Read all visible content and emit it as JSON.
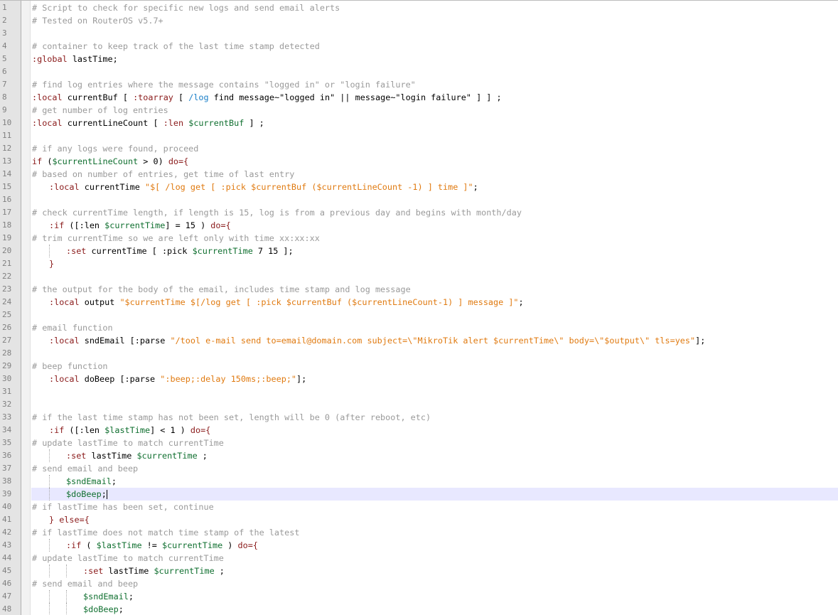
{
  "editor": {
    "current_line": 39,
    "lines": [
      {
        "n": "1",
        "indent": 0,
        "tokens": [
          {
            "t": "c",
            "v": "# Script to check for specific new logs and send email alerts"
          }
        ]
      },
      {
        "n": "2",
        "indent": 0,
        "tokens": [
          {
            "t": "c",
            "v": "# Tested on RouterOS v5.7+"
          }
        ]
      },
      {
        "n": "3",
        "indent": 0,
        "tokens": []
      },
      {
        "n": "4",
        "indent": 0,
        "tokens": [
          {
            "t": "c",
            "v": "# container to keep track of the last time stamp detected"
          }
        ]
      },
      {
        "n": "5",
        "indent": 0,
        "tokens": [
          {
            "t": "k",
            "v": ":global"
          },
          {
            "t": "p",
            "v": " lastTime;"
          }
        ]
      },
      {
        "n": "6",
        "indent": 0,
        "tokens": []
      },
      {
        "n": "7",
        "indent": 0,
        "tokens": [
          {
            "t": "c",
            "v": "# find log entries where the message contains \"logged in\" or \"login failure\""
          }
        ]
      },
      {
        "n": "8",
        "indent": 0,
        "tokens": [
          {
            "t": "k",
            "v": ":local"
          },
          {
            "t": "p",
            "v": " currentBuf "
          },
          {
            "t": "s",
            "v": "[ "
          },
          {
            "t": "k",
            "v": ":toarray"
          },
          {
            "t": "s",
            "v": " [ "
          },
          {
            "t": "path",
            "v": "/log"
          },
          {
            "t": "p",
            "v": " find message~\"logged in\" || message~\"login failure\" "
          },
          {
            "t": "s",
            "v": "] ] ;"
          }
        ]
      },
      {
        "n": "9",
        "indent": 0,
        "tokens": [
          {
            "t": "c",
            "v": "# get number of log entries"
          }
        ]
      },
      {
        "n": "10",
        "indent": 0,
        "tokens": [
          {
            "t": "k",
            "v": ":local"
          },
          {
            "t": "p",
            "v": " currentLineCount "
          },
          {
            "t": "s",
            "v": "[ "
          },
          {
            "t": "k",
            "v": ":len"
          },
          {
            "t": "v",
            "v": " $currentBuf"
          },
          {
            "t": "s",
            "v": " ] ;"
          }
        ]
      },
      {
        "n": "11",
        "indent": 0,
        "tokens": []
      },
      {
        "n": "12",
        "indent": 0,
        "tokens": [
          {
            "t": "c",
            "v": "# if any logs were found, proceed"
          }
        ]
      },
      {
        "n": "13",
        "indent": 0,
        "tokens": [
          {
            "t": "k",
            "v": "if"
          },
          {
            "t": "p",
            "v": " ("
          },
          {
            "t": "v",
            "v": "$currentLineCount"
          },
          {
            "t": "p",
            "v": " > 0) "
          },
          {
            "t": "k",
            "v": "do={"
          }
        ]
      },
      {
        "n": "14",
        "indent": 0,
        "tokens": [
          {
            "t": "c",
            "v": "# based on number of entries, get time of last entry"
          }
        ]
      },
      {
        "n": "15",
        "indent": 1,
        "tokens": [
          {
            "t": "k",
            "v": ":local"
          },
          {
            "t": "p",
            "v": " currentTime "
          },
          {
            "t": "str",
            "v": "\"$[ /log get [ :pick $currentBuf ($currentLineCount -1) ] time ]\""
          },
          {
            "t": "p",
            "v": ";"
          }
        ]
      },
      {
        "n": "16",
        "indent": 0,
        "tokens": []
      },
      {
        "n": "17",
        "indent": 0,
        "tokens": [
          {
            "t": "c",
            "v": "# check currentTime length, if length is 15, log is from a previous day and begins with month/day"
          }
        ]
      },
      {
        "n": "18",
        "indent": 1,
        "tokens": [
          {
            "t": "k",
            "v": ":if"
          },
          {
            "t": "p",
            "v": " ([:len "
          },
          {
            "t": "v",
            "v": "$currentTime"
          },
          {
            "t": "p",
            "v": "] = 15 ) "
          },
          {
            "t": "k",
            "v": "do={"
          }
        ]
      },
      {
        "n": "19",
        "indent": 0,
        "tokens": [
          {
            "t": "c",
            "v": "# trim currentTime so we are left only with time xx:xx:xx"
          }
        ]
      },
      {
        "n": "20",
        "indent": 2,
        "tokens": [
          {
            "t": "k",
            "v": ":set"
          },
          {
            "t": "p",
            "v": " currentTime [ :pick "
          },
          {
            "t": "v",
            "v": "$currentTime"
          },
          {
            "t": "p",
            "v": " 7 15 ];"
          }
        ]
      },
      {
        "n": "21",
        "indent": 1,
        "tokens": [
          {
            "t": "k",
            "v": "}"
          }
        ]
      },
      {
        "n": "22",
        "indent": 0,
        "tokens": []
      },
      {
        "n": "23",
        "indent": 0,
        "tokens": [
          {
            "t": "c",
            "v": "# the output for the body of the email, includes time stamp and log message"
          }
        ]
      },
      {
        "n": "24",
        "indent": 1,
        "tokens": [
          {
            "t": "k",
            "v": ":local"
          },
          {
            "t": "p",
            "v": " output "
          },
          {
            "t": "str",
            "v": "\"$currentTime $[/log get [ :pick $currentBuf ($currentLineCount-1) ] message ]\""
          },
          {
            "t": "p",
            "v": ";"
          }
        ]
      },
      {
        "n": "25",
        "indent": 0,
        "tokens": []
      },
      {
        "n": "26",
        "indent": 0,
        "tokens": [
          {
            "t": "c",
            "v": "# email function"
          }
        ]
      },
      {
        "n": "27",
        "indent": 1,
        "tokens": [
          {
            "t": "k",
            "v": ":local"
          },
          {
            "t": "p",
            "v": " sndEmail [:parse "
          },
          {
            "t": "str",
            "v": "\"/tool e-mail send to=email@domain.com subject=\\\"MikroTik alert $currentTime\\\" body=\\\"$output\\\" tls=yes\""
          },
          {
            "t": "p",
            "v": "];"
          }
        ]
      },
      {
        "n": "28",
        "indent": 0,
        "tokens": []
      },
      {
        "n": "29",
        "indent": 0,
        "tokens": [
          {
            "t": "c",
            "v": "# beep function"
          }
        ]
      },
      {
        "n": "30",
        "indent": 1,
        "tokens": [
          {
            "t": "k",
            "v": ":local"
          },
          {
            "t": "p",
            "v": " doBeep [:parse "
          },
          {
            "t": "str",
            "v": "\":beep;:delay 150ms;:beep;\""
          },
          {
            "t": "p",
            "v": "];"
          }
        ]
      },
      {
        "n": "31",
        "indent": 0,
        "tokens": []
      },
      {
        "n": "32",
        "indent": 0,
        "tokens": []
      },
      {
        "n": "33",
        "indent": 0,
        "tokens": [
          {
            "t": "c",
            "v": "# if the last time stamp has not been set, length will be 0 (after reboot, etc)"
          }
        ]
      },
      {
        "n": "34",
        "indent": 1,
        "tokens": [
          {
            "t": "k",
            "v": ":if"
          },
          {
            "t": "p",
            "v": " ([:len "
          },
          {
            "t": "v",
            "v": "$lastTime"
          },
          {
            "t": "p",
            "v": "] < 1 ) "
          },
          {
            "t": "k",
            "v": "do={"
          }
        ]
      },
      {
        "n": "35",
        "indent": 0,
        "tokens": [
          {
            "t": "c",
            "v": "# update lastTime to match currentTime"
          }
        ]
      },
      {
        "n": "36",
        "indent": 2,
        "tokens": [
          {
            "t": "k",
            "v": ":set"
          },
          {
            "t": "p",
            "v": " lastTime "
          },
          {
            "t": "v",
            "v": "$currentTime"
          },
          {
            "t": "p",
            "v": " ;"
          }
        ]
      },
      {
        "n": "37",
        "indent": 0,
        "tokens": [
          {
            "t": "c",
            "v": "# send email and beep"
          }
        ]
      },
      {
        "n": "38",
        "indent": 2,
        "tokens": [
          {
            "t": "v",
            "v": "$sndEmail"
          },
          {
            "t": "p",
            "v": ";"
          }
        ]
      },
      {
        "n": "39",
        "indent": 2,
        "tokens": [
          {
            "t": "v",
            "v": "$doBeep"
          },
          {
            "t": "p",
            "v": ";"
          }
        ]
      },
      {
        "n": "40",
        "indent": 0,
        "tokens": [
          {
            "t": "c",
            "v": "# if lastTime has been set, continue"
          }
        ]
      },
      {
        "n": "41",
        "indent": 1,
        "tokens": [
          {
            "t": "k",
            "v": "} else={"
          }
        ]
      },
      {
        "n": "42",
        "indent": 0,
        "tokens": [
          {
            "t": "c",
            "v": "# if lastTime does not match time stamp of the latest"
          }
        ]
      },
      {
        "n": "43",
        "indent": 2,
        "tokens": [
          {
            "t": "k",
            "v": ":if"
          },
          {
            "t": "p",
            "v": " ( "
          },
          {
            "t": "v",
            "v": "$lastTime"
          },
          {
            "t": "p",
            "v": " != "
          },
          {
            "t": "v",
            "v": "$currentTime"
          },
          {
            "t": "p",
            "v": " ) "
          },
          {
            "t": "k",
            "v": "do={"
          }
        ]
      },
      {
        "n": "44",
        "indent": 0,
        "tokens": [
          {
            "t": "c",
            "v": "# update lastTime to match currentTime"
          }
        ]
      },
      {
        "n": "45",
        "indent": 3,
        "tokens": [
          {
            "t": "k",
            "v": ":set"
          },
          {
            "t": "p",
            "v": " lastTime "
          },
          {
            "t": "v",
            "v": "$currentTime"
          },
          {
            "t": "p",
            "v": " ;"
          }
        ]
      },
      {
        "n": "46",
        "indent": 0,
        "tokens": [
          {
            "t": "c",
            "v": "# send email and beep"
          }
        ]
      },
      {
        "n": "47",
        "indent": 3,
        "tokens": [
          {
            "t": "v",
            "v": "$sndEmail"
          },
          {
            "t": "p",
            "v": ";"
          }
        ]
      },
      {
        "n": "48",
        "indent": 3,
        "tokens": [
          {
            "t": "v",
            "v": "$doBeep"
          },
          {
            "t": "p",
            "v": ";"
          }
        ]
      }
    ]
  }
}
